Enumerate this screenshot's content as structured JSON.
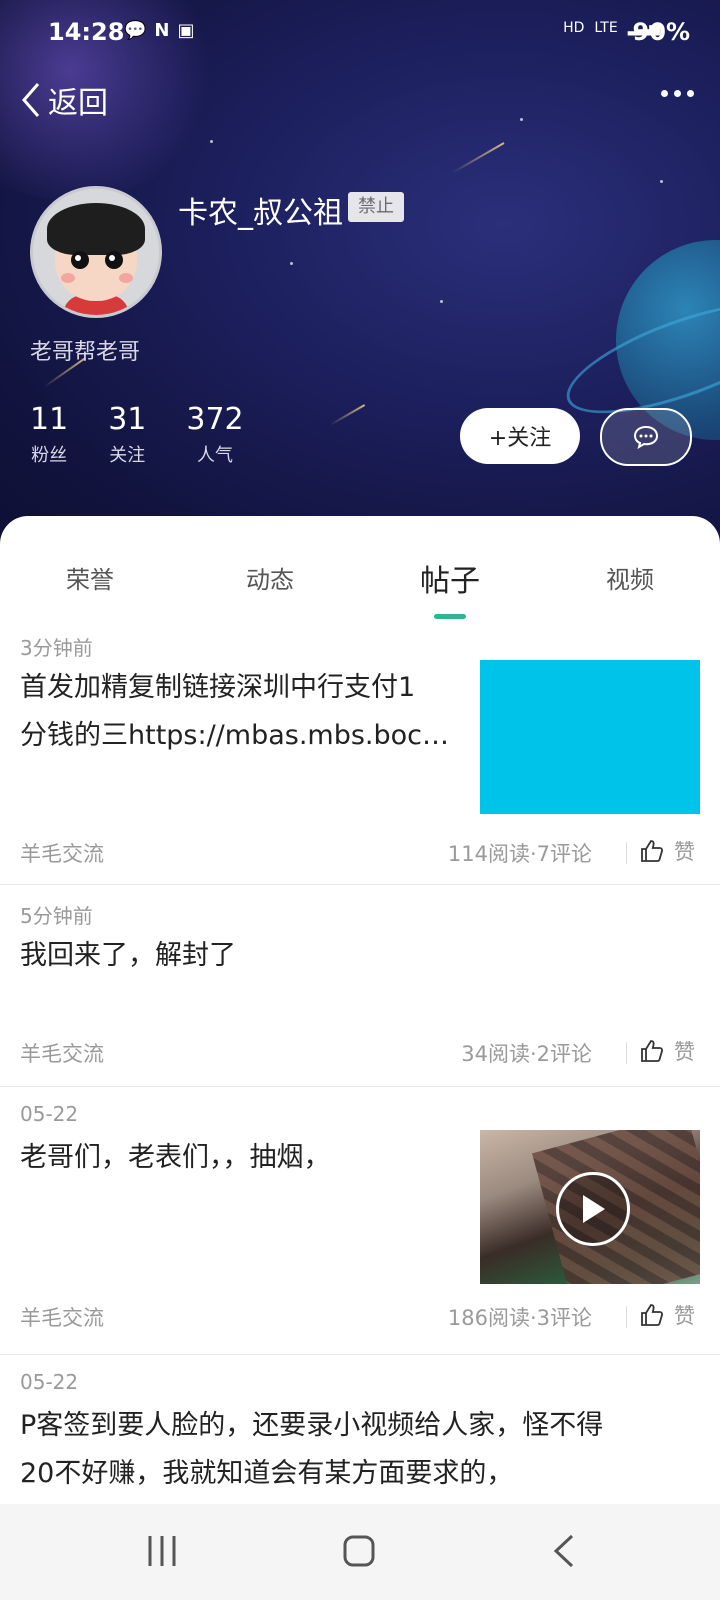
{
  "status_bar": {
    "time": "14:28",
    "network": "HD",
    "signal_type": "LTE",
    "battery": "90%"
  },
  "header": {
    "back_label": "返回",
    "username": "卡农_叔公祖",
    "status_badge": "禁止",
    "bio": "老哥帮老哥",
    "stats": [
      {
        "value": "11",
        "label": "粉丝"
      },
      {
        "value": "31",
        "label": "关注"
      },
      {
        "value": "372",
        "label": "人气"
      }
    ],
    "follow_label": "+关注"
  },
  "tabs": [
    {
      "label": "荣誉",
      "active": false
    },
    {
      "label": "动态",
      "active": false
    },
    {
      "label": "帖子",
      "active": true
    },
    {
      "label": "视频",
      "active": false
    }
  ],
  "posts": [
    {
      "time": "3分钟前",
      "lines": [
        "首发加精复制链接深圳中行支付1",
        "分钱的三https://mbas.mbs.boc…"
      ],
      "tag": "羊毛交流",
      "meta": "114阅读·7评论",
      "like": "赞"
    },
    {
      "time": "5分钟前",
      "lines": [
        "我回来了，解封了"
      ],
      "tag": "羊毛交流",
      "meta": "34阅读·2评论",
      "like": "赞"
    },
    {
      "time": "05-22",
      "lines": [
        "老哥们，老表们，，抽烟，"
      ],
      "tag": "羊毛交流",
      "meta": "186阅读·3评论",
      "like": "赞"
    },
    {
      "time": "05-22",
      "lines": [
        "P客签到要人脸的，还要录小视频给人家，怪不得",
        "20不好赚，我就知道会有某方面要求的，"
      ]
    }
  ],
  "colors": {
    "accent": "#2fb494",
    "header_bg": "#1c1f5c",
    "thumb_cyan": "#00c3ea"
  },
  "icons": {
    "back": "chevron-left-icon",
    "more": "more-dots-icon",
    "message": "chat-bubble-icon",
    "like": "thumbs-up-icon",
    "play": "play-icon"
  }
}
